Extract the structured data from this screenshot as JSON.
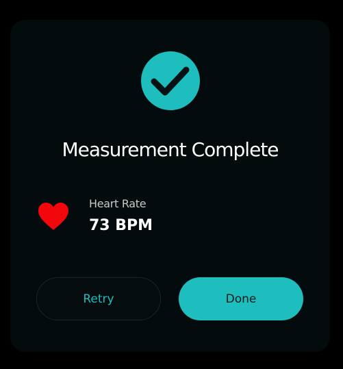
{
  "dialog": {
    "title": "Measurement Complete",
    "status_icon": "checkmark-icon",
    "metric": {
      "icon": "heart-icon",
      "label": "Heart Rate",
      "value": "73 BPM"
    },
    "buttons": {
      "retry_label": "Retry",
      "done_label": "Done"
    }
  },
  "colors": {
    "accent": "#1ebdbe",
    "heart": "#f2070d",
    "card_background": "#040b0c",
    "page_background": "#000000"
  }
}
